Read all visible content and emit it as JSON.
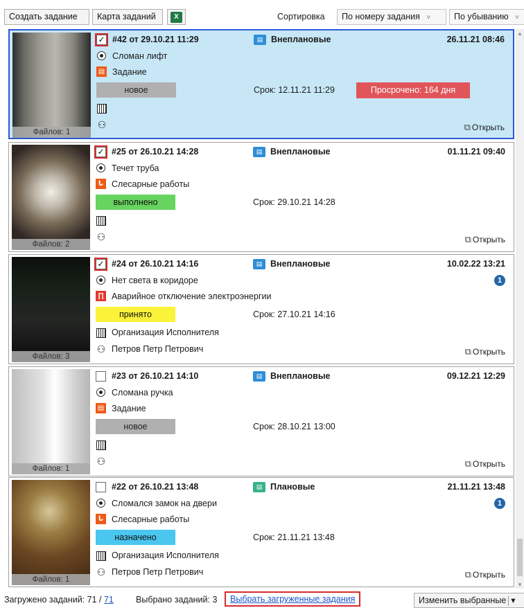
{
  "toolbar": {
    "create_label": "Создать задание",
    "map_label": "Карта заданий",
    "excel_icon": "excel-icon",
    "excel_glyph": "X",
    "sort_label": "Сортировка",
    "sort_by": "По номеру задания",
    "sort_dir": "По убыванию",
    "chevron": "˅"
  },
  "icons": {
    "check": "✓",
    "task_type": "▤",
    "cat_task": "▤",
    "cat_plumbing": "ᒐ",
    "cat_power": "∏",
    "user": "⚇",
    "open": "⧉"
  },
  "cards": [
    {
      "checked": true,
      "selected": true,
      "header": "#42  от  29.10.21 11:29",
      "type": "Внеплановые",
      "date": "26.11.21 08:46",
      "name": "Сломан лифт",
      "category": "Задание",
      "status": "новое",
      "status_color": "#b0b0b0",
      "due": "Срок: 12.11.21 11:29",
      "overdue": "Просрочено: 164 дня",
      "org": "",
      "user": "",
      "badge": "",
      "files": "Файлов: 1",
      "open": "Открыть",
      "photo": "elevator-photo"
    },
    {
      "checked": true,
      "selected": false,
      "header": "#25  от  26.10.21 14:28",
      "type": "Внеплановые",
      "date": "01.11.21 09:40",
      "name": "Течет труба",
      "category": "Слесарные работы",
      "status": "выполнено",
      "status_color": "#66d45e",
      "due": "Срок: 29.10.21 14:28",
      "overdue": "",
      "org": "",
      "user": "",
      "badge": "",
      "files": "Файлов: 2",
      "open": "Открыть",
      "photo": "pipe-photo"
    },
    {
      "checked": true,
      "selected": false,
      "header": "#24  от  26.10.21 14:16",
      "type": "Внеплановые",
      "date": "10.02.22 13:21",
      "name": "Нет света в коридоре",
      "category": "Аварийное отключение электроэнергии",
      "status": "принято",
      "status_color": "#fbf33a",
      "due": "Срок: 27.10.21 14:16",
      "overdue": "",
      "org": "Организация Исполнителя",
      "user": "Петров Петр Петрович",
      "badge": "1",
      "files": "Файлов: 3",
      "open": "Открыть",
      "photo": "corridor-photo"
    },
    {
      "checked": false,
      "selected": false,
      "header": "#23  от  26.10.21 14:10",
      "type": "Внеплановые",
      "date": "09.12.21 12:29",
      "name": "Сломана ручка",
      "category": "Задание",
      "status": "новое",
      "status_color": "#b0b0b0",
      "due": "Срок: 28.10.21 13:00",
      "overdue": "",
      "org": "",
      "user": "",
      "badge": "",
      "files": "Файлов: 1",
      "open": "Открыть",
      "photo": "handle-photo"
    },
    {
      "checked": false,
      "selected": false,
      "header": "#22  от  26.10.21 13:48",
      "type": "Плановые",
      "date": "21.11.21 13:48",
      "name": "Сломался замок на двери",
      "category": "Слесарные работы",
      "status": "назначено",
      "status_color": "#4ac6ef",
      "due": "Срок: 21.11.21 13:48",
      "overdue": "",
      "org": "Организация Исполнителя",
      "user": "Петров Петр Петрович",
      "badge": "1",
      "files": "Файлов: 1",
      "open": "Открыть",
      "photo": "lock-photo"
    }
  ],
  "footer": {
    "loaded_label": "Загружено заданий: 71 /",
    "loaded_link": "71",
    "selected_label": "Выбрано заданий: 3",
    "select_loaded": "Выбрать загруженные задания",
    "change_selected": "Изменить выбранные",
    "dropdown": "▾"
  },
  "scrollbar": {
    "up": "▴",
    "down": "▾"
  }
}
